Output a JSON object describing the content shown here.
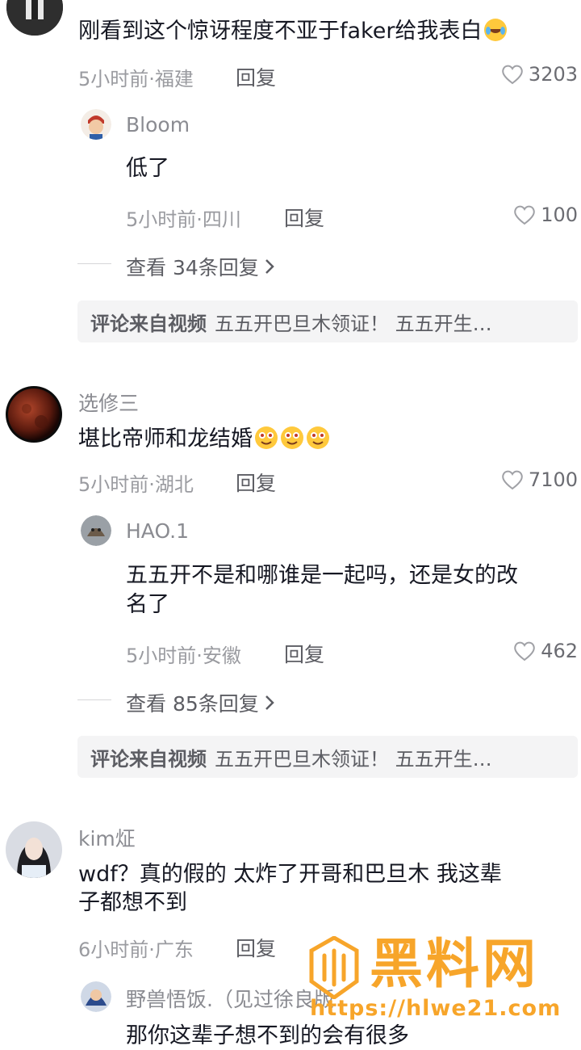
{
  "comments": [
    {
      "text": "刚看到这个惊讶程度不亚于faker给我表白",
      "time_location": "5小时前·福建",
      "reply_label": "回复",
      "likes": "3203",
      "reply": {
        "name": "Bloom",
        "text": "低了",
        "time_location": "5小时前·四川",
        "reply_label": "回复",
        "likes": "100"
      },
      "more_replies": "查看 34条回复",
      "source_label": "评论来自视频",
      "source_text": "五五开巴旦木领证！ 五五开生…"
    },
    {
      "name": "选修三",
      "text": "堪比帝师和龙结婚",
      "time_location": "5小时前·湖北",
      "reply_label": "回复",
      "likes": "7100",
      "reply": {
        "name": "HAO.1",
        "text_line1": "五五开不是和哪谁是一起吗，还是女的改",
        "text_line2": "名了",
        "time_location": "5小时前·安徽",
        "reply_label": "回复",
        "likes": "462"
      },
      "more_replies": "查看 85条回复",
      "source_label": "评论来自视频",
      "source_text": "五五开巴旦木领证！ 五五开生…"
    },
    {
      "name": "kim炡",
      "text_line1": "wdf？真的假的 太炸了开哥和巴旦木 我这辈",
      "text_line2": "子都想不到",
      "time_location": "6小时前·广东",
      "reply_label": "回复",
      "reply": {
        "name": "野兽悟饭.（见过徐良版",
        "text_partial": "那你这辈子想不到的会有很多"
      }
    }
  ],
  "watermark": {
    "brand": "黑料网",
    "url": "https://hlwe21.com"
  },
  "colors": {
    "text": "#161823",
    "secondary": "#8a8b91",
    "watermark": "#f7a52a"
  }
}
